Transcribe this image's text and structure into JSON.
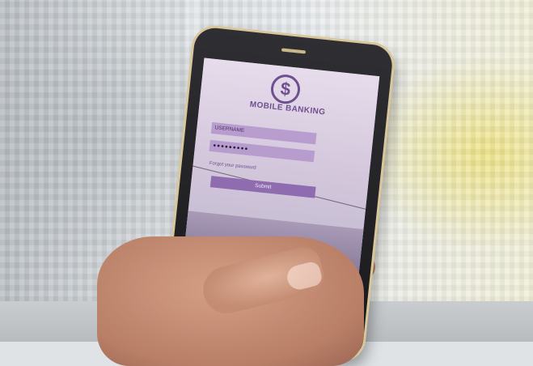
{
  "app": {
    "logo_symbol": "$",
    "title": "MOBILE BANKING"
  },
  "login": {
    "username_placeholder": "USERNAME",
    "password_value": "●●●●●●●●●",
    "forgot_link": "Forgot your password",
    "submit_label": "Submit"
  },
  "colors": {
    "brand_purple": "#6e4f8f",
    "field_purple": "#ac8cc8",
    "button_purple": "#8f6bb0"
  },
  "icons": {
    "logo": "dollar-sign-icon"
  }
}
